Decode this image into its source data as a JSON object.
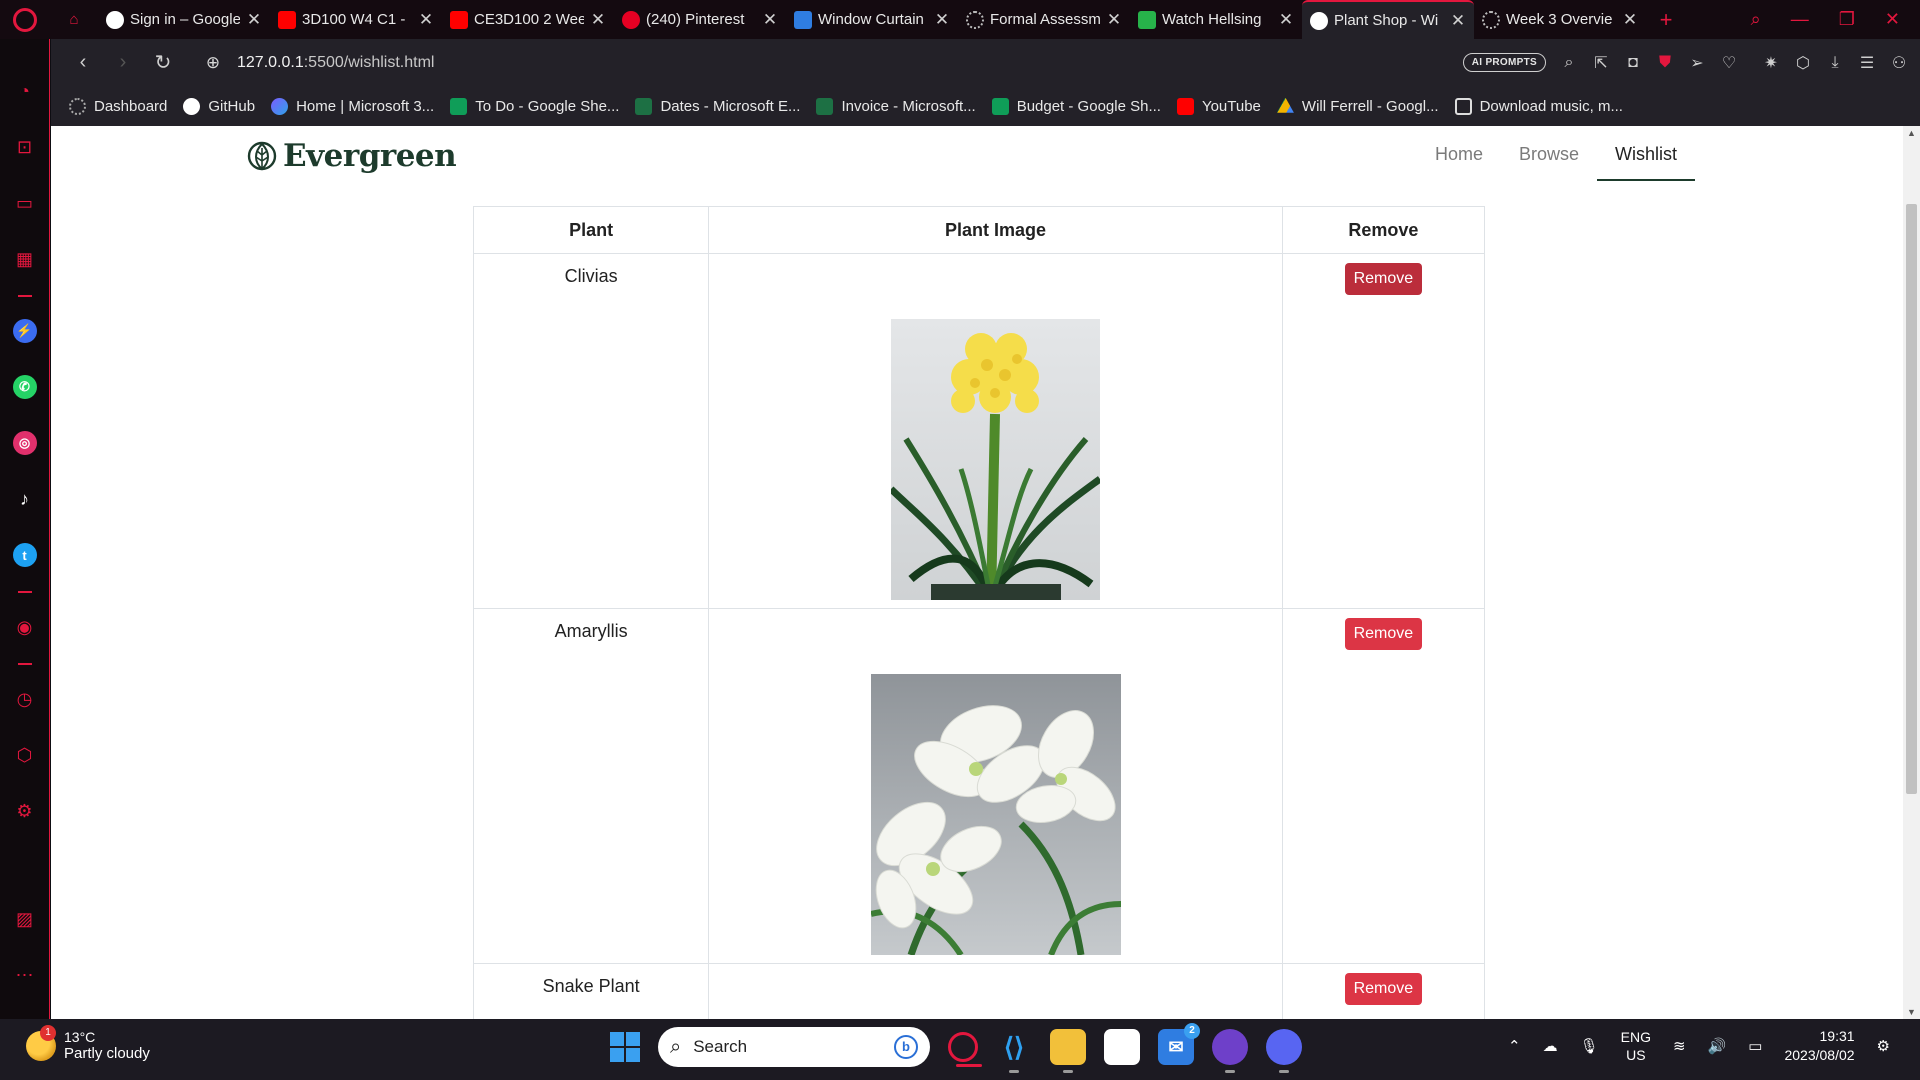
{
  "browser": {
    "tabs": [
      {
        "title": "Sign in – Google",
        "fav_color": "#ffffff",
        "fav_glyph": "G",
        "active": false
      },
      {
        "title": "3D100 W4 C1 -",
        "fav_color": "#ff0000",
        "fav_glyph": "▶",
        "active": false
      },
      {
        "title": "CE3D100 2 Wee",
        "fav_color": "#ff0000",
        "fav_glyph": "▶",
        "active": false
      },
      {
        "title": "(240) Pinterest",
        "fav_color": "#e60023",
        "fav_glyph": "P",
        "active": false
      },
      {
        "title": "Window Curtain",
        "fav_color": "#2f7de1",
        "fav_glyph": "W",
        "active": false
      },
      {
        "title": "Formal Assessm",
        "fav_color": "#777777",
        "fav_glyph": "◌",
        "active": false
      },
      {
        "title": "Watch Hellsing",
        "fav_color": "#27b24a",
        "fav_glyph": "V",
        "active": false
      },
      {
        "title": "Plant Shop - Wi",
        "fav_color": "#ffffff",
        "fav_glyph": "◍",
        "active": true
      },
      {
        "title": "Week 3 Overvie",
        "fav_color": "#777777",
        "fav_glyph": "◌",
        "active": false
      }
    ],
    "url_host": "127.0.0.1",
    "url_path": ":5500/wishlist.html",
    "ai_prompts_label": "AI PROMPTS",
    "bookmarks": [
      {
        "label": "Dashboard",
        "fav_color": "#2b2b2b",
        "glyph": "◌"
      },
      {
        "label": "GitHub",
        "fav_color": "#ffffff",
        "glyph": "●"
      },
      {
        "label": "Home | Microsoft 3...",
        "fav_color": "#7b5cff",
        "glyph": "◆"
      },
      {
        "label": "To Do - Google She...",
        "fav_color": "#0f9d58",
        "glyph": "+"
      },
      {
        "label": "Dates - Microsoft E...",
        "fav_color": "#1d7044",
        "glyph": "x"
      },
      {
        "label": "Invoice - Microsoft...",
        "fav_color": "#1d7044",
        "glyph": "x"
      },
      {
        "label": "Budget - Google Sh...",
        "fav_color": "#0f9d58",
        "glyph": "+"
      },
      {
        "label": "YouTube",
        "fav_color": "#ff0000",
        "glyph": "▶"
      },
      {
        "label": "Will Ferrell - Googl...",
        "fav_color": "#f4b400",
        "glyph": "▲"
      },
      {
        "label": "Download music, m...",
        "fav_color": "#dddddd",
        "glyph": "▣"
      }
    ]
  },
  "site": {
    "brand": "Evergreen",
    "nav": [
      {
        "label": "Home",
        "active": false
      },
      {
        "label": "Browse",
        "active": false
      },
      {
        "label": "Wishlist",
        "active": true
      }
    ],
    "table": {
      "headers": [
        "Plant",
        "Plant Image",
        "Remove"
      ],
      "rows": [
        {
          "plant": "Clivias",
          "button": "Remove"
        },
        {
          "plant": "Amaryllis",
          "button": "Remove"
        },
        {
          "plant": "Snake Plant",
          "button": "Remove"
        }
      ]
    }
  },
  "taskbar": {
    "weather_temp": "13°C",
    "weather_desc": "Partly cloudy",
    "weather_badge": "1",
    "search_placeholder": "Search",
    "mail_badge": "2",
    "lang_top": "ENG",
    "lang_bottom": "US",
    "time": "19:31",
    "date": "2023/08/02"
  },
  "colors": {
    "opera_red": "#e3173e",
    "brand_green": "#1d3b2c",
    "remove_red": "#dc3545"
  }
}
